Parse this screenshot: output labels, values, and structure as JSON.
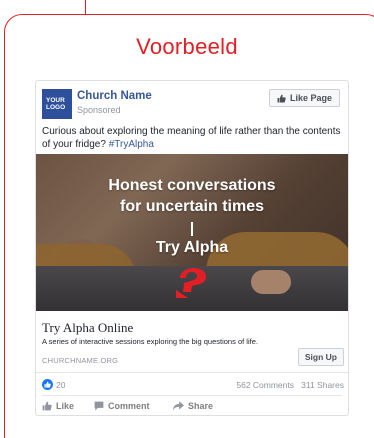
{
  "heading": "Voorbeeld",
  "ad": {
    "logo_line1": "YOUR",
    "logo_line2": "LOGO",
    "page_name": "Church Name",
    "sponsored": "Sponsored",
    "like_page_label": "Like Page",
    "post_text": "Curious about exploring the meaning of life rather than the contents of your fridge?",
    "hashtag": "#TryAlpha",
    "image": {
      "line1": "Honest conversations",
      "line2": "for uncertain times",
      "line3": "Try Alpha"
    },
    "link_title": "Try Alpha Online",
    "link_description": "A series of interactive sessions exploring the big questions of life.",
    "link_domain": "CHURCHNAME.ORG",
    "cta_label": "Sign Up",
    "reactions_count": "20",
    "comments": "562 Comments",
    "shares": "311 Shares",
    "actions": {
      "like": "Like",
      "comment": "Comment",
      "share": "Share"
    }
  },
  "colors": {
    "accent_red": "#e31e24",
    "facebook_blue": "#365899",
    "logo_blue": "#2d4f9c",
    "like_blue": "#1877f2"
  },
  "icons": [
    "thumbs-up-icon",
    "comment-icon",
    "share-icon",
    "alpha-question-mark-icon"
  ]
}
